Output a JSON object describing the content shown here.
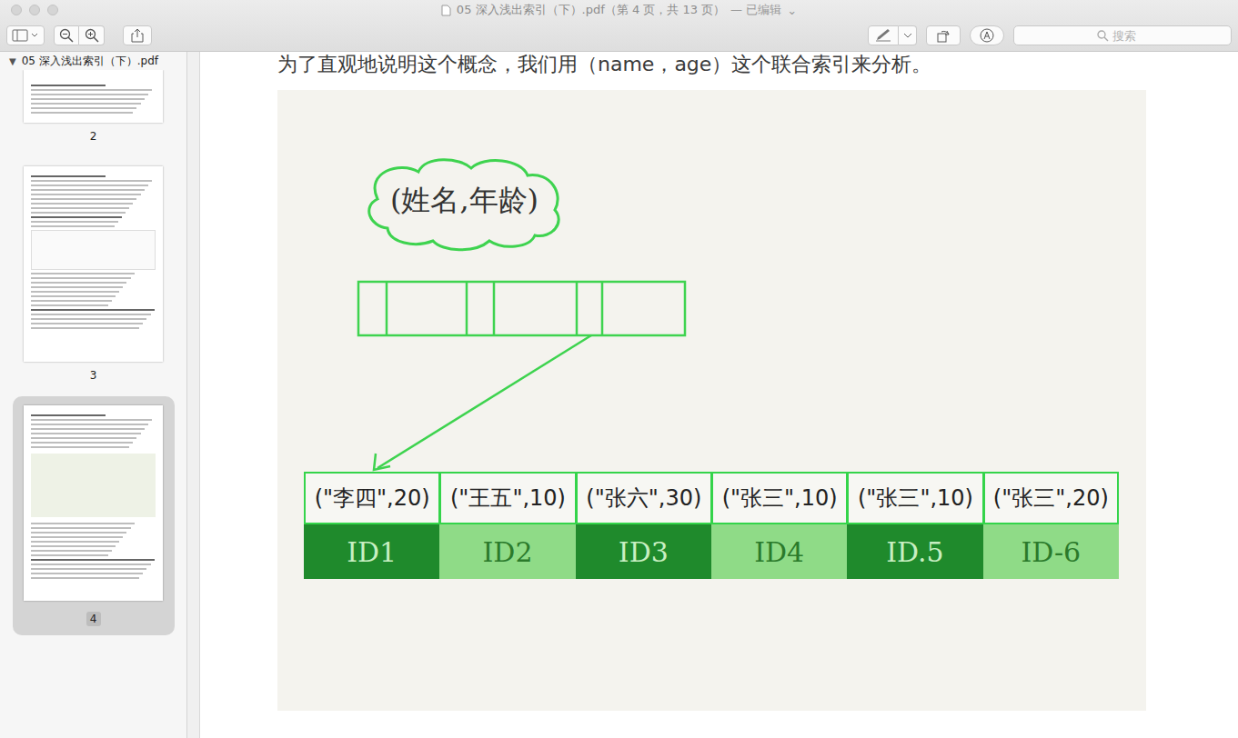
{
  "window": {
    "title": "05  深入浅出索引（下）.pdf（第 4 页，共 13 页）",
    "edited": "— 已编辑",
    "edited_menu": "⌄"
  },
  "toolbar": {
    "search": {
      "placeholder": "搜索"
    }
  },
  "sidebar": {
    "toggle": "▼",
    "expanded": true,
    "document": "05  深入浅出索引（下）.pdf",
    "thumbnails": [
      {
        "label": "2",
        "selected": false
      },
      {
        "label": "3",
        "selected": false
      },
      {
        "label": "4",
        "selected": true
      }
    ]
  },
  "page": {
    "text": "为了直观地说明这个概念，我们用（name，age）这个联合索引来分析。",
    "diagram": {
      "label": "(姓名,年龄)",
      "entries": [
        {
          "key": "(\"李四\",20)",
          "id": "ID1",
          "color": "#1f8a2c"
        },
        {
          "key": "(\"王五\",10)",
          "id": "ID2",
          "color": "#8fdb87"
        },
        {
          "key": "(\"张六\",30)",
          "id": "ID3",
          "color": "#1f8a2c"
        },
        {
          "key": "(\"张三\",10)",
          "id": "ID4",
          "color": "#8fdb87"
        },
        {
          "key": "(\"张三\",10)",
          "id": "ID.5",
          "color": "#1f8a2c"
        },
        {
          "key": "(\"张三\",20)",
          "id": "ID-6",
          "color": "#8fdb87"
        }
      ]
    }
  }
}
